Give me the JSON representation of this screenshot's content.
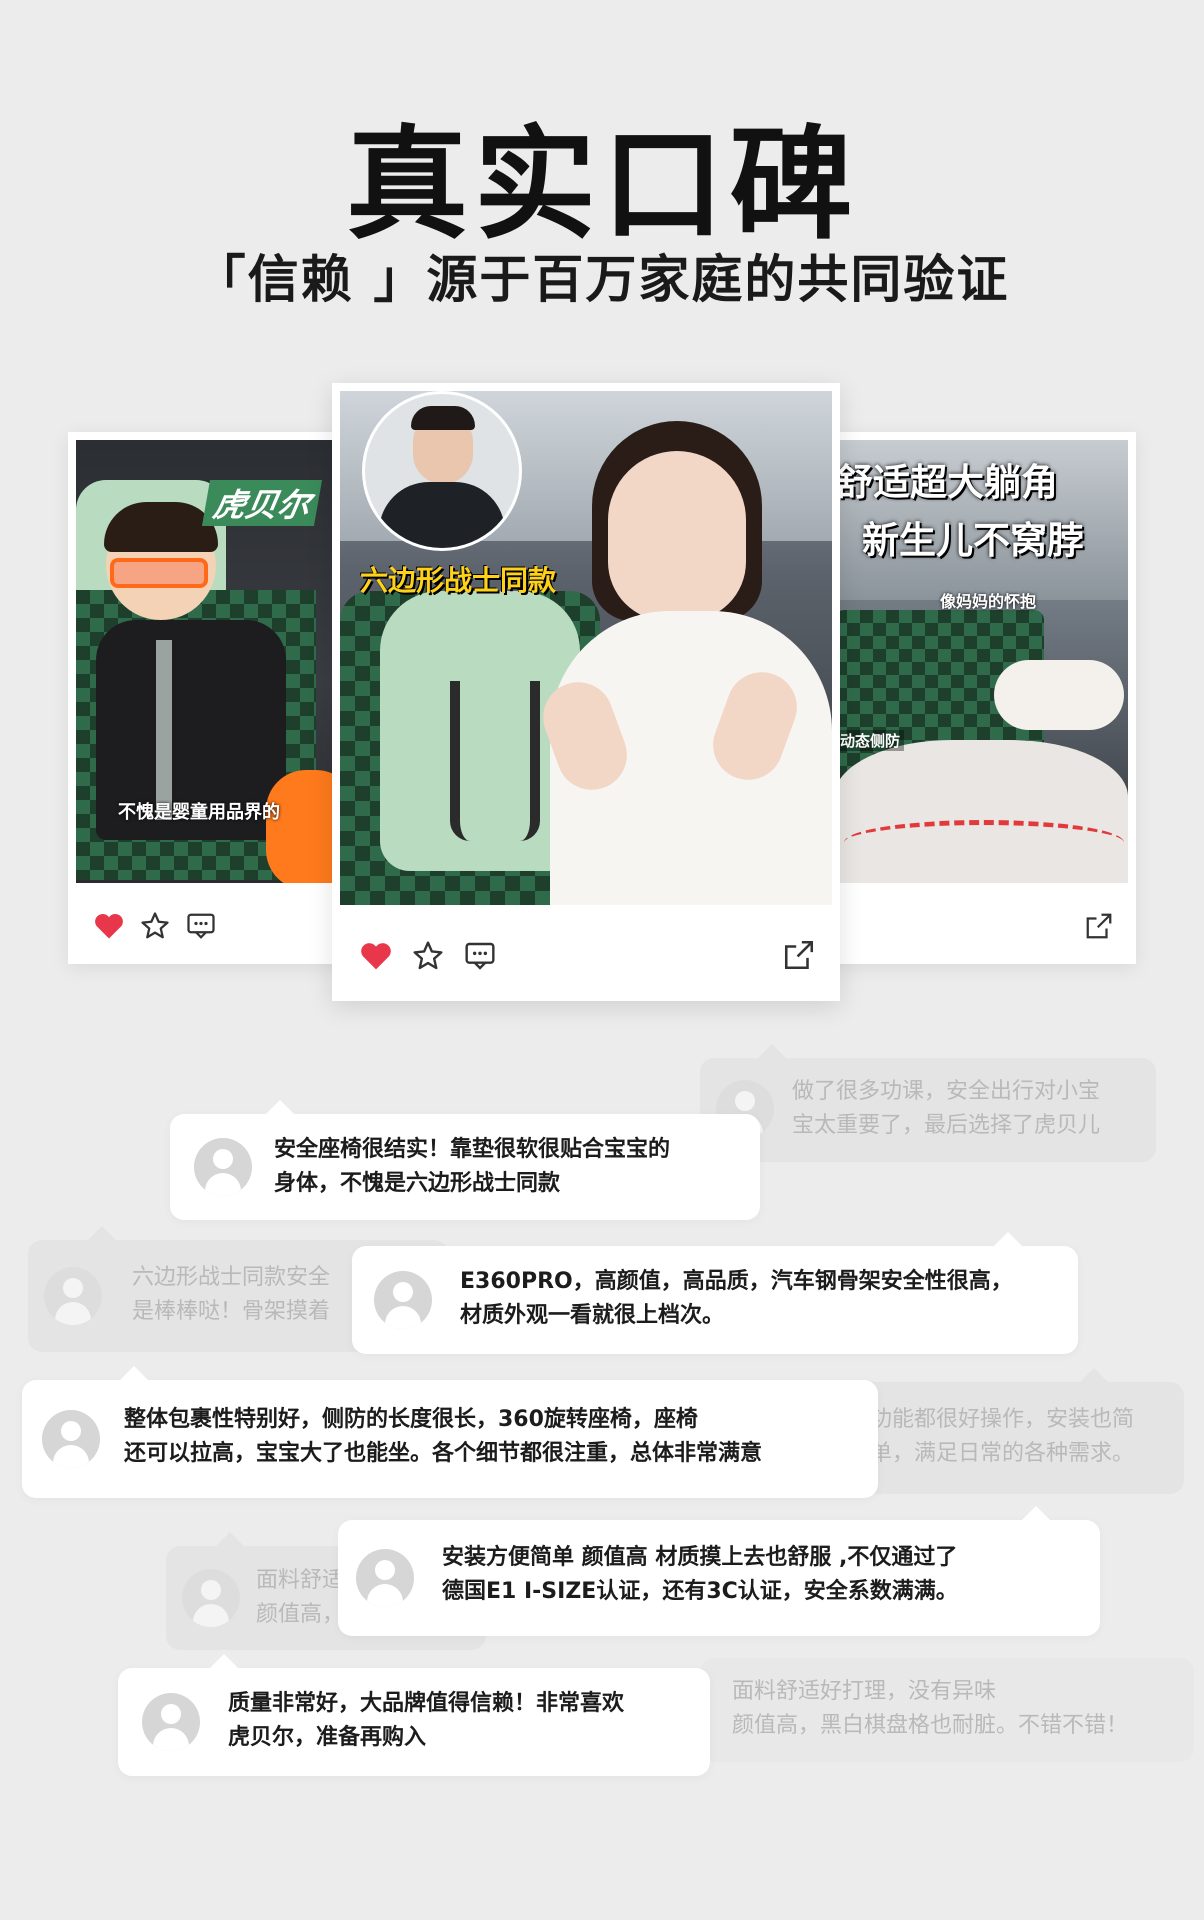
{
  "header": {
    "title": "真实口碑",
    "subtitle": "「信赖 」源于百万家庭的共同验证"
  },
  "cards": {
    "left": {
      "overlay_brand": "虎贝尔",
      "overlay_caption": "不愧是婴童用品界的"
    },
    "center": {
      "overlay_label": "六边形战士同款"
    },
    "right": {
      "overlay_line1": "舒适超大躺角",
      "overlay_line2": "新生儿不窝脖",
      "overlay_small": "像妈妈的怀抱",
      "overlay_tag": "动态侧防"
    }
  },
  "icons": {
    "like": "heart-icon",
    "favorite": "star-icon",
    "comment": "comment-icon",
    "share": "share-icon"
  },
  "colors": {
    "background": "#ececec",
    "heart": "#e8374a",
    "seat_green": "#2f6b4a",
    "seat_mint": "#b9dcc1"
  },
  "reviews": [
    {
      "line1": "做了很多功课，安全出行对小宝",
      "line2": "宝太重要了，最后选择了虎贝儿"
    },
    {
      "line1": "安全座椅很结实！靠垫很软很贴合宝宝的",
      "line2": "身体，不愧是六边形战士同款"
    },
    {
      "line1": "六边形战士同款安全",
      "line2": "是棒棒哒！骨架摸着"
    },
    {
      "line1": "E360PRO，高颜值，高品质，汽车钢骨架安全性很高，",
      "line2": "材质外观一看就很上档次。"
    },
    {
      "line1": "整体包裹性特别好，侧防的长度很长，360旋转座椅，座椅",
      "line2": "还可以拉高，宝宝大了也能坐。各个细节都很注重，总体非常满意"
    },
    {
      "line1": "功能都很好操作，安装也简",
      "line2": "单，满足日常的各种需求。"
    },
    {
      "line1": "安装方便简单 颜值高 材质摸上去也舒服 ,不仅通过了",
      "line2": "德国E1 I-SIZE认证，还有3C认证，安全系数满满。"
    },
    {
      "line1": "面料舒适",
      "line2": "颜值高，"
    },
    {
      "line1": "质量非常好，大品牌值得信赖！非常喜欢",
      "line2": "虎贝尔，准备再购入"
    },
    {
      "line1": "面料舒适好打理，没有异味",
      "line2": "颜值高，黑白棋盘格也耐脏。不错不错！"
    }
  ]
}
